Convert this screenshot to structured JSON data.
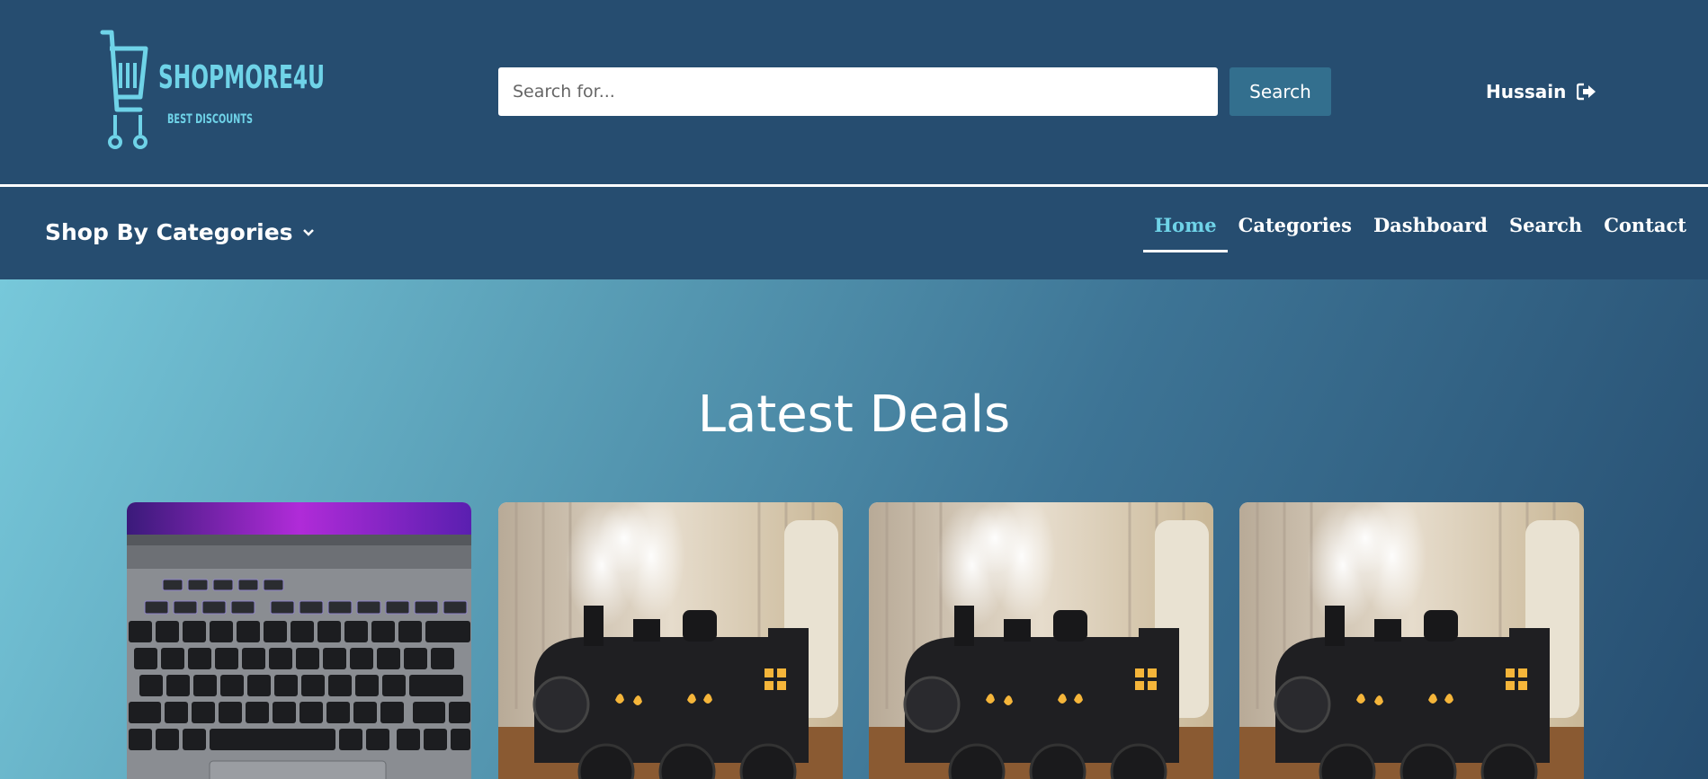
{
  "header": {
    "logo": {
      "brand": "SHOPMORE4U",
      "tagline": "BEST DISCOUNTS",
      "icon": "shopping-cart-icon"
    },
    "search": {
      "placeholder": "Search for...",
      "value": "",
      "button_label": "Search"
    },
    "user": {
      "name": "Hussain",
      "icon": "sign-out-icon"
    }
  },
  "nav": {
    "categories_dropdown": {
      "label": "Shop By Categories",
      "icon": "chevron-down-icon"
    },
    "links": [
      {
        "label": "Home",
        "active": true
      },
      {
        "label": "Categories",
        "active": false
      },
      {
        "label": "Dashboard",
        "active": false
      },
      {
        "label": "Search",
        "active": false
      },
      {
        "label": "Contact",
        "active": false
      }
    ]
  },
  "main": {
    "section_title": "Latest Deals",
    "deals": [
      {
        "image": "laptop-keyboard"
      },
      {
        "image": "steam-train-humidifier"
      },
      {
        "image": "steam-train-humidifier"
      },
      {
        "image": "steam-train-humidifier"
      }
    ]
  },
  "colors": {
    "header_bg": "#264d70",
    "button_bg": "#336f8e",
    "active_link": "#6fd3e8",
    "logo": "#6fd3e8"
  }
}
